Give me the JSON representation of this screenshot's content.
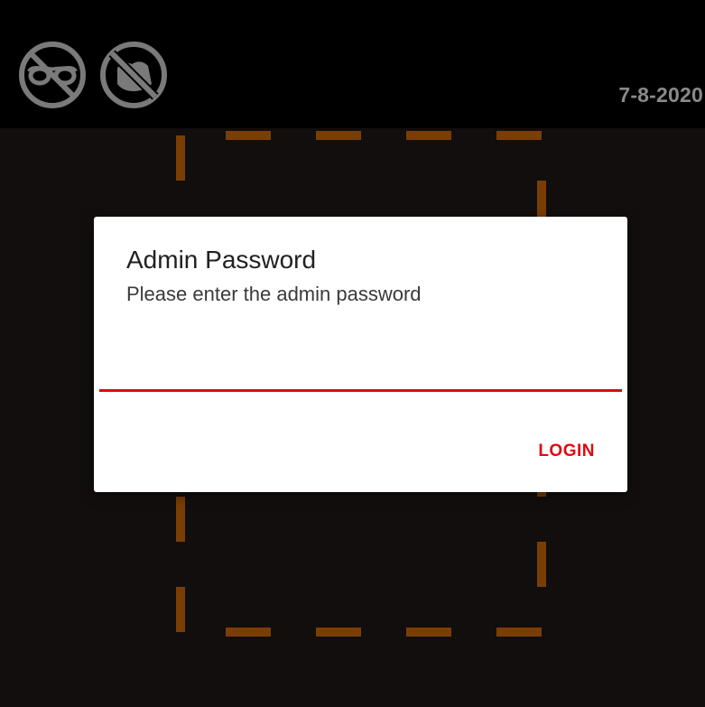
{
  "status_bar": {
    "date": "7-8-2020",
    "icons": [
      "no-glasses-icon",
      "no-mask-icon"
    ]
  },
  "dialog": {
    "title": "Admin Password",
    "message": "Please enter the admin password",
    "password_value": "",
    "login_label": "LOGIN"
  },
  "colors": {
    "accent": "#e0080f",
    "frame": "#7a3e05",
    "icon": "#7a7a7a",
    "topbar": "#000000",
    "background": "#120e0d"
  }
}
